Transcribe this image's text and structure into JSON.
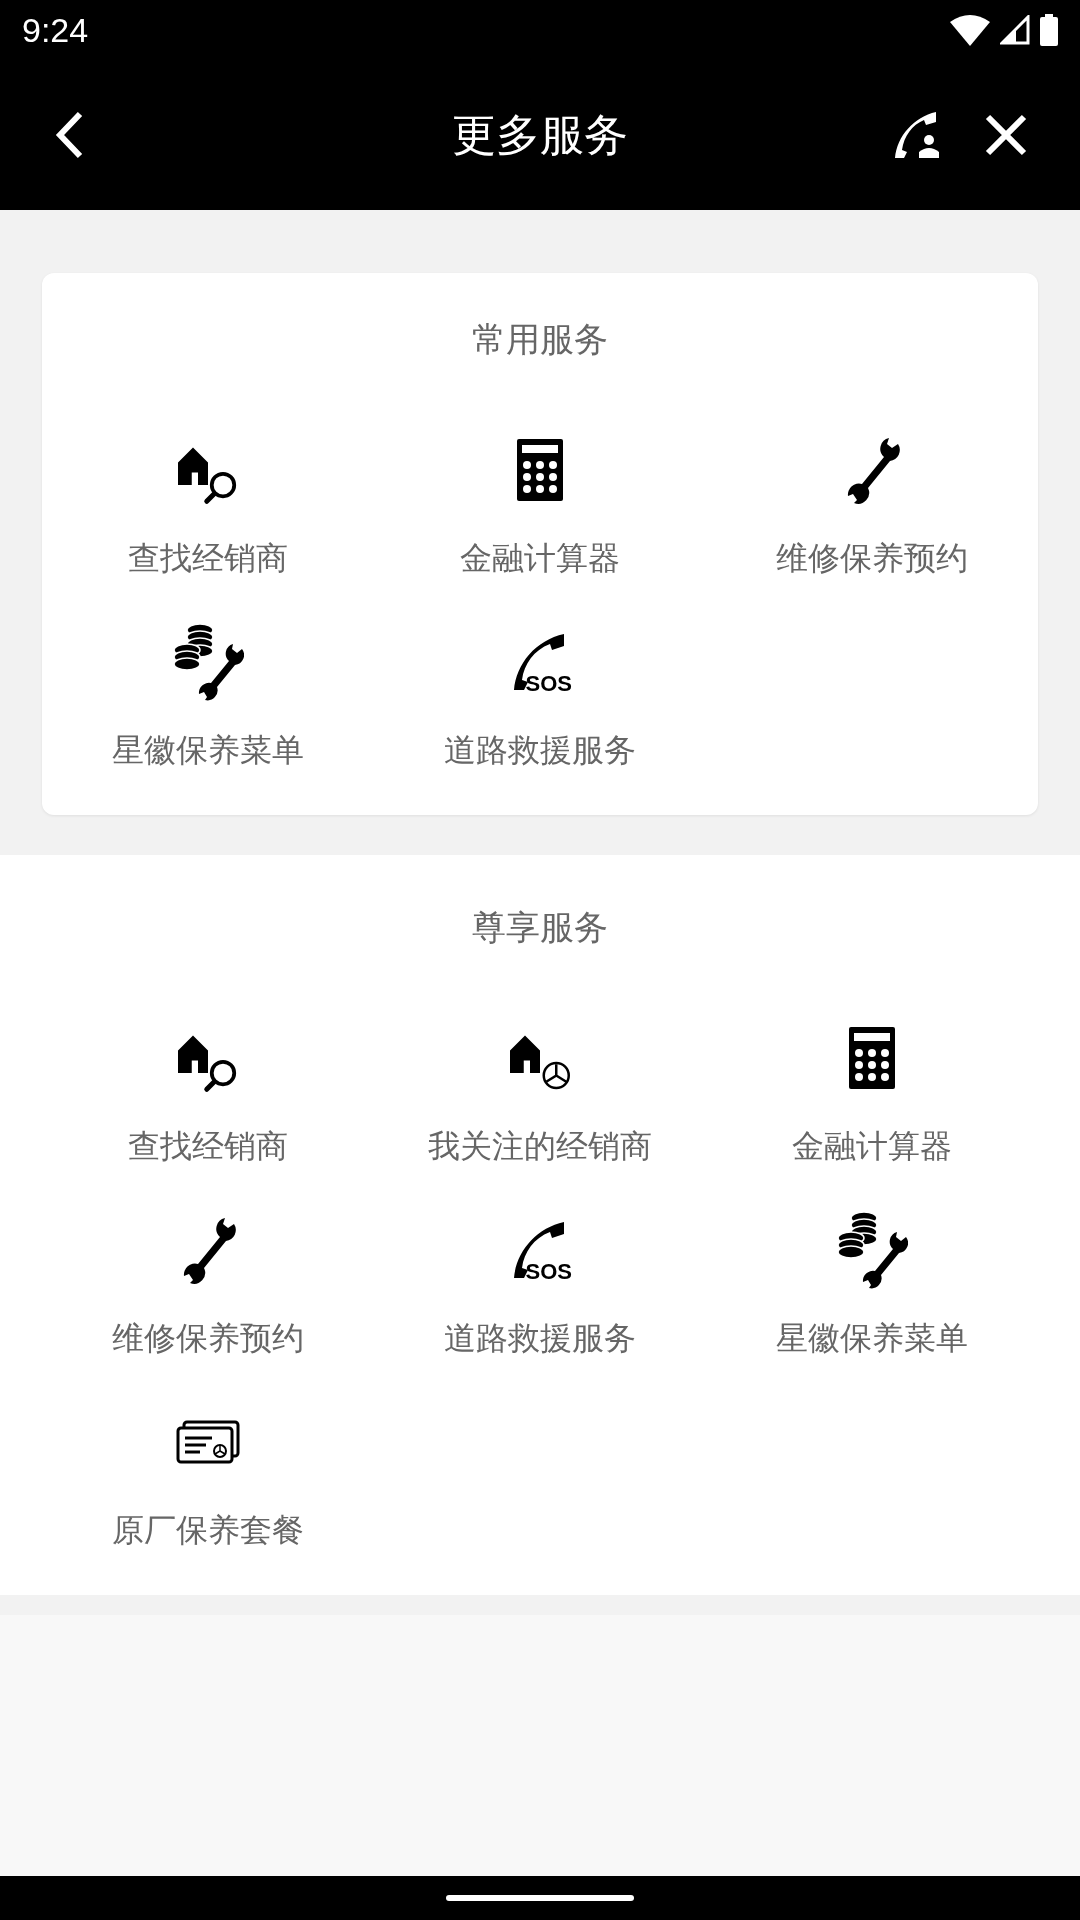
{
  "status_bar": {
    "time": "9:24"
  },
  "header": {
    "title": "更多服务"
  },
  "sections": [
    {
      "title": "常用服务",
      "kind": "card",
      "items": [
        {
          "kind": "dealer-search",
          "label": "查找经销商"
        },
        {
          "kind": "calculator",
          "label": "金融计算器"
        },
        {
          "kind": "wrench",
          "label": "维修保养预约"
        },
        {
          "kind": "coins-wrench",
          "label": "星徽保养菜单"
        },
        {
          "kind": "phone-sos",
          "label": "道路救援服务",
          "badge": "SOS"
        }
      ]
    },
    {
      "title": "尊享服务",
      "kind": "panel",
      "items": [
        {
          "kind": "dealer-search",
          "label": "查找经销商"
        },
        {
          "kind": "dealer-star",
          "label": "我关注的经销商"
        },
        {
          "kind": "calculator",
          "label": "金融计算器"
        },
        {
          "kind": "wrench",
          "label": "维修保养预约"
        },
        {
          "kind": "phone-sos",
          "label": "道路救援服务",
          "badge": "SOS"
        },
        {
          "kind": "coins-wrench",
          "label": "星徽保养菜单"
        },
        {
          "kind": "package-card",
          "label": "原厂保养套餐"
        }
      ]
    }
  ]
}
